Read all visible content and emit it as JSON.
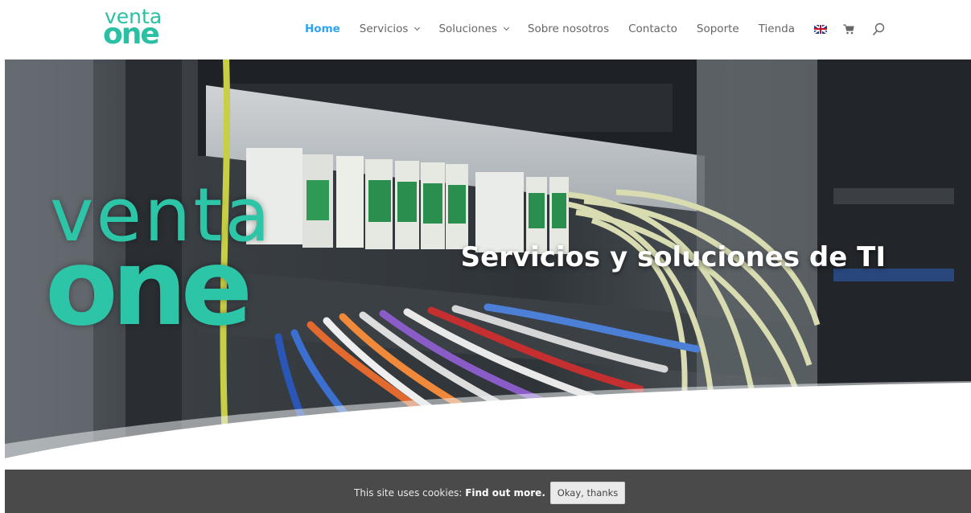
{
  "brand": {
    "logo_line1": "venta",
    "logo_line2": "one",
    "accent_color": "#2bbfa4"
  },
  "nav": {
    "items": [
      {
        "label": "Home",
        "active": true
      },
      {
        "label": "Servicios",
        "has_dropdown": true
      },
      {
        "label": "Soluciones",
        "has_dropdown": true
      },
      {
        "label": "Sobre nosotros"
      },
      {
        "label": "Contacto"
      },
      {
        "label": "Soporte"
      },
      {
        "label": "Tienda"
      }
    ],
    "icons": [
      "uk-flag-icon",
      "cart-icon",
      "search-icon"
    ],
    "active_color": "#2ea3f2"
  },
  "hero": {
    "logo_line1": "venta",
    "logo_line2": "one",
    "title": "Servicios y soluciones de TI"
  },
  "cookie_bar": {
    "text": "This site uses cookies: ",
    "link_text": "Find out more.",
    "button_label": "Okay, thanks"
  }
}
